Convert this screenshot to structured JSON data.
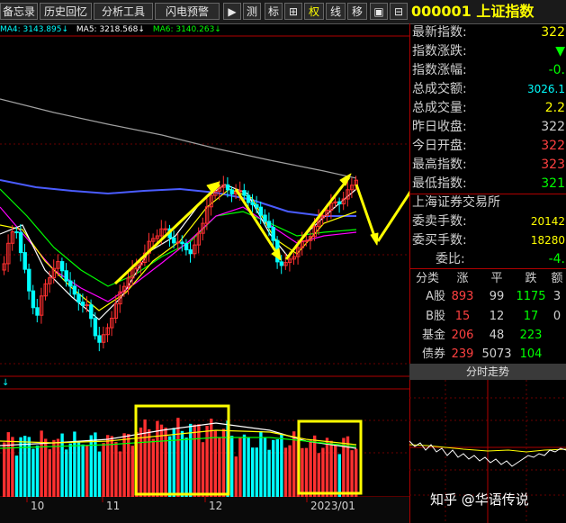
{
  "toolbar": {
    "buttons": [
      "备忘录",
      "历史回忆",
      "分析工具",
      "闪电预警"
    ],
    "icon_buttons": [
      "测",
      "标",
      "权",
      "线",
      "移"
    ]
  },
  "stock": {
    "code_name": "000001 上证指数"
  },
  "ma_legend": [
    {
      "label": "MA4: 3143.895",
      "color": "#00ffff"
    },
    {
      "label": "MA5: 3218.568",
      "color": "#ffffff"
    },
    {
      "label": "MA6: 3140.263",
      "color": "#00ff00"
    }
  ],
  "quote": {
    "rows": [
      {
        "label": "最新指数:",
        "value": "322",
        "color": "#ffff00"
      },
      {
        "label": "指数涨跌:",
        "value": "▼",
        "color": "#00ff00"
      },
      {
        "label": "指数涨幅:",
        "value": "-0.",
        "color": "#00ff00"
      },
      {
        "label": "总成交额:",
        "value": "3026.1",
        "color": "#00ffff"
      },
      {
        "label": "总成交量:",
        "value": "2.2",
        "color": "#ffff00"
      },
      {
        "label": "昨日收盘:",
        "value": "322",
        "color": "#d0d0d0"
      },
      {
        "label": "今日开盘:",
        "value": "322",
        "color": "#ff4040"
      },
      {
        "label": "最高指数:",
        "value": "323",
        "color": "#ff4040"
      },
      {
        "label": "最低指数:",
        "value": "321",
        "color": "#00ff00"
      }
    ],
    "exchange": "上海证券交易所",
    "rows2": [
      {
        "label": "委卖手数:",
        "value": "20142",
        "color": "#ffff00"
      },
      {
        "label": "委买手数:",
        "value": "18280",
        "color": "#ffff00"
      },
      {
        "label": "委比:",
        "value": "-4.",
        "color": "#00ff00"
      }
    ]
  },
  "breakdown": {
    "headers": [
      "分类",
      "涨",
      "平",
      "跌",
      "额"
    ],
    "rows": [
      {
        "cat": "A股",
        "up": "893",
        "flat": "99",
        "down": "1175",
        "amt": "3"
      },
      {
        "cat": "B股",
        "up": "15",
        "flat": "12",
        "down": "17",
        "amt": "0"
      },
      {
        "cat": "基金",
        "up": "206",
        "flat": "48",
        "down": "223",
        "amt": ""
      },
      {
        "cat": "债券",
        "up": "239",
        "flat": "5073",
        "down": "104",
        "amt": ""
      }
    ]
  },
  "fenshi_tab": "分时走势",
  "x_axis": [
    "10",
    "11",
    "12",
    "2023/01"
  ],
  "volume_marker": "↓",
  "watermark": "知乎 @华语传说",
  "colors": {
    "up": "#ff3030",
    "down": "#00ffff",
    "ma_white": "#ffffff",
    "ma_yellow": "#ffff00",
    "ma_magenta": "#ff00ff",
    "ma_green": "#00ff00",
    "ma_blue": "#4a5cff",
    "ma_gray": "#a0a0a0",
    "grid": "#b00000",
    "arrow": "#ffff00"
  }
}
